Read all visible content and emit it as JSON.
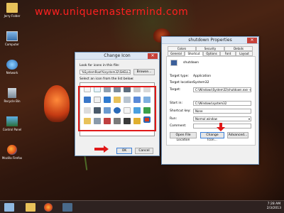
{
  "watermark": "www.uniquemastermind.com",
  "desktop_icons": [
    {
      "label": "Jerry Folder"
    },
    {
      "label": "Computer"
    },
    {
      "label": "Network"
    },
    {
      "label": "Recycle Bin"
    },
    {
      "label": "Control Panel"
    },
    {
      "label": "Mozilla Firefox"
    }
  ],
  "change_icon": {
    "title": "Change Icon",
    "close": "✕",
    "look_for_label": "Look for icons in this file:",
    "path": "%SystemRoot%\\system32\\SHELL32",
    "browse": "Browse...",
    "select_label": "Select an icon from the list below:",
    "ok": "OK",
    "cancel": "Cancel"
  },
  "properties": {
    "title": "shutdown Properties",
    "close": "✕",
    "tabs_top": [
      "Colors",
      "Security",
      "Details"
    ],
    "tabs_bottom": [
      "General",
      "Shortcut",
      "Options",
      "Font",
      "Layout"
    ],
    "name": "shutdown",
    "target_type_label": "Target type:",
    "target_type": "Application",
    "target_location_label": "Target location:",
    "target_location": "System32",
    "target_label": "Target:",
    "target": "C:\\Windows\\System32\\shutdown.exe -s -t 00",
    "start_in_label": "Start in:",
    "start_in": "C:\\Windows\\system32",
    "shortcut_key_label": "Shortcut key:",
    "shortcut_key": "None",
    "run_label": "Run:",
    "run": "Normal window",
    "comment_label": "Comment:",
    "open_file_location": "Open File Location",
    "change_icon": "Change Icon...",
    "advanced": "Advanced..."
  },
  "clock": {
    "time": "7:28 AM",
    "date": "2/3/2013"
  },
  "colors": {
    "accent_red": "#e01818"
  }
}
